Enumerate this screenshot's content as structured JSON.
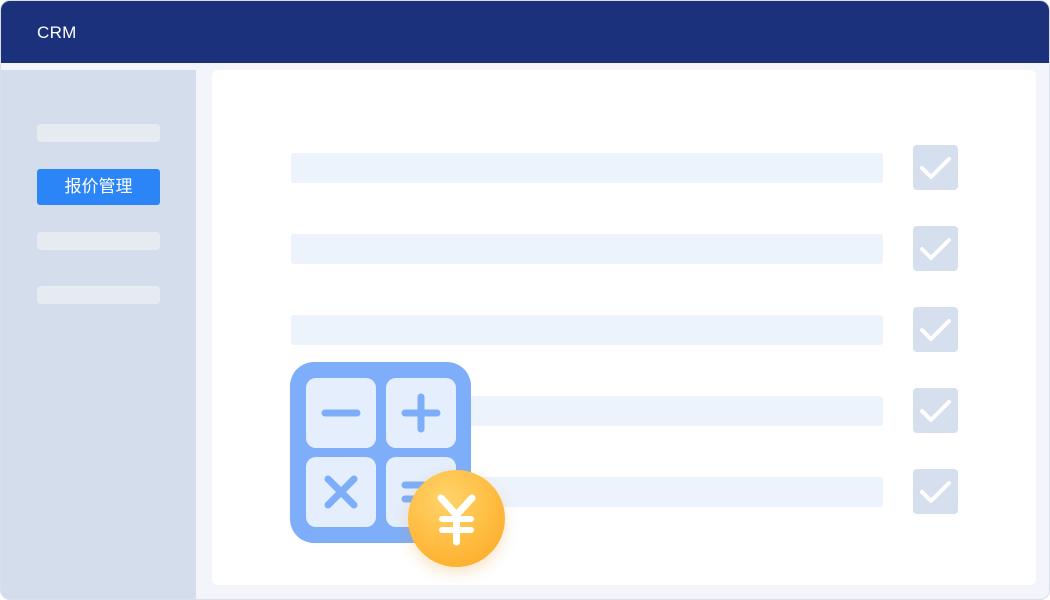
{
  "app": {
    "title": "CRM"
  },
  "sidebar": {
    "items": [
      {
        "label": ""
      },
      {
        "label": "报价管理",
        "active": true
      },
      {
        "label": ""
      },
      {
        "label": ""
      }
    ]
  },
  "main": {
    "rows": [
      {
        "checked": true
      },
      {
        "checked": true
      },
      {
        "checked": true
      },
      {
        "checked": true
      },
      {
        "checked": true
      }
    ]
  },
  "illustration": {
    "icons": [
      "calculator-icon",
      "minus-icon",
      "plus-icon",
      "multiply-icon",
      "equals-icon",
      "yuan-coin-icon"
    ]
  },
  "colors": {
    "titlebar": "#1c317c",
    "sidebar": "#d3ddec",
    "active_item": "#2b85f6",
    "calculator": "#7eaef9",
    "coin": "#ffbb3f"
  }
}
